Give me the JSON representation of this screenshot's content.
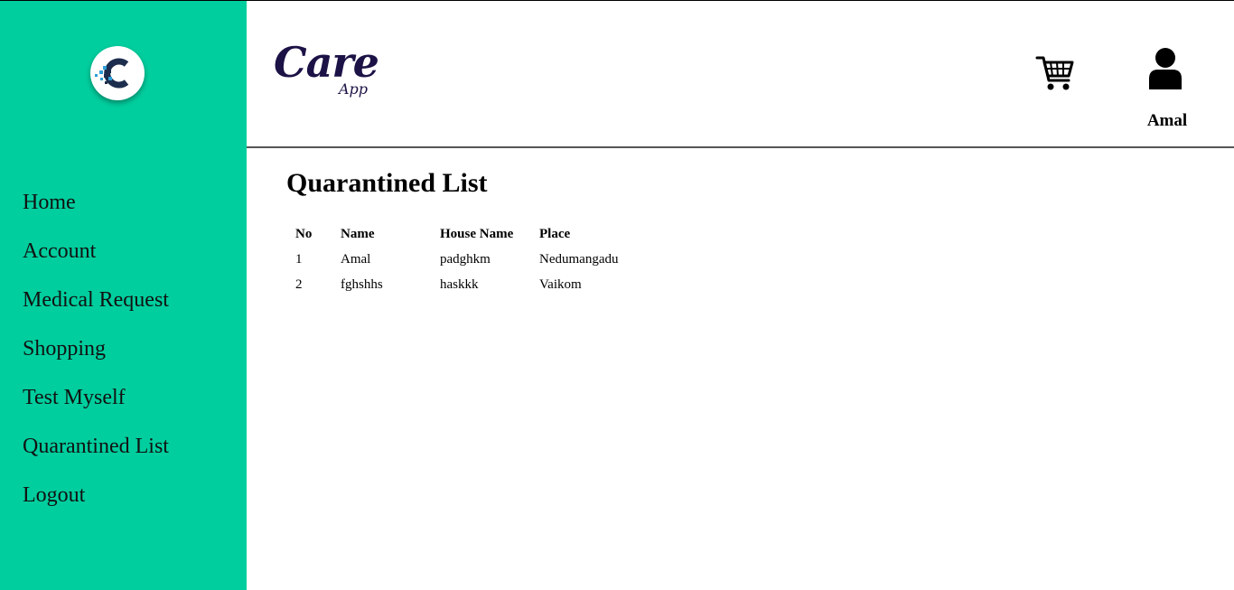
{
  "sidebar": {
    "logo_icon": "care-app-c-logo-icon",
    "background": "#00ce9e",
    "items": [
      {
        "label": "Home"
      },
      {
        "label": "Account"
      },
      {
        "label": "Medical Request"
      },
      {
        "label": "Shopping"
      },
      {
        "label": "Test Myself"
      },
      {
        "label": "Quarantined List"
      },
      {
        "label": "Logout"
      }
    ]
  },
  "header": {
    "brand_primary": "Care",
    "brand_secondary": "App",
    "brand_color": "#1d1246",
    "cart_icon": "shopping-cart-icon",
    "user_icon": "user-profile-icon",
    "user_name": "Amal"
  },
  "main": {
    "title": "Quarantined List",
    "table": {
      "headers": [
        "No",
        "Name",
        "House Name",
        "Place"
      ],
      "rows": [
        [
          "1",
          "Amal",
          "padghkm",
          "Nedumangadu"
        ],
        [
          "2",
          "fghshhs",
          "haskkk",
          "Vaikom"
        ]
      ]
    }
  }
}
